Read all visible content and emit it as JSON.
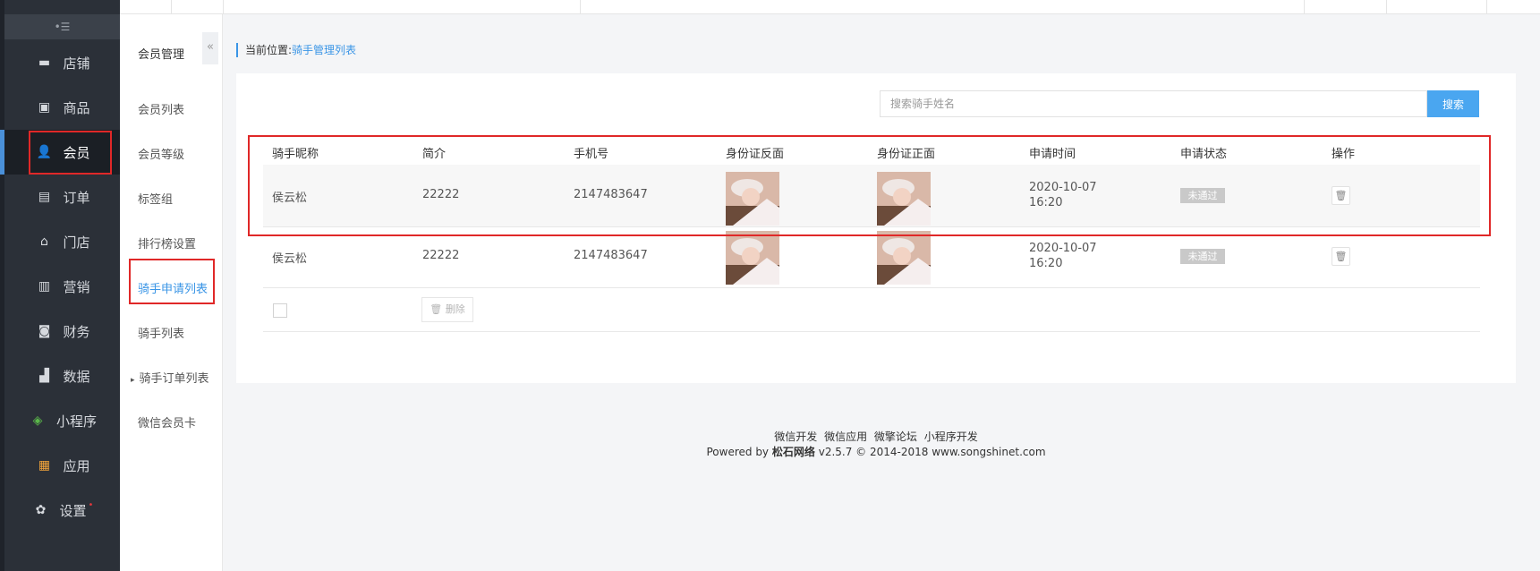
{
  "sidebar": {
    "collapse_glyph": "•☰",
    "items": [
      {
        "label": "店铺",
        "icon": "store-icon",
        "glyph": "▬"
      },
      {
        "label": "商品",
        "icon": "goods-icon",
        "glyph": "▣"
      },
      {
        "label": "会员",
        "icon": "member-icon",
        "glyph": "👤"
      },
      {
        "label": "订单",
        "icon": "order-icon",
        "glyph": "▤"
      },
      {
        "label": "门店",
        "icon": "shop-icon",
        "glyph": "⌂"
      },
      {
        "label": "营销",
        "icon": "gift-icon",
        "glyph": "▥"
      },
      {
        "label": "财务",
        "icon": "money-bag-icon",
        "glyph": "◙"
      },
      {
        "label": "数据",
        "icon": "chart-icon",
        "glyph": "▟"
      },
      {
        "label": "小程序",
        "icon": "miniprogram-icon",
        "glyph": "◈"
      },
      {
        "label": "应用",
        "icon": "apps-icon",
        "glyph": "▦"
      },
      {
        "label": "设置",
        "icon": "gear-icon",
        "glyph": "✿",
        "dot": "•"
      }
    ]
  },
  "subnav": {
    "title": "会员管理",
    "fold_glyph": "«",
    "items": [
      {
        "label": "会员列表"
      },
      {
        "label": "会员等级"
      },
      {
        "label": "标签组"
      },
      {
        "label": "排行榜设置"
      },
      {
        "label": "骑手申请列表"
      },
      {
        "label": "骑手列表"
      },
      {
        "label": "骑手订单列表",
        "tri": "▸"
      },
      {
        "label": "微信会员卡"
      }
    ]
  },
  "breadcrumb": {
    "prefix": "当前位置:",
    "current": "骑手管理列表"
  },
  "search": {
    "placeholder": "搜索骑手姓名",
    "button": "搜索"
  },
  "table": {
    "headers": [
      "骑手昵称",
      "简介",
      "手机号",
      "身份证反面",
      "身份证正面",
      "申请时间",
      "申请状态",
      "操作"
    ],
    "rows": [
      {
        "name": "侯云松",
        "intro": "22222",
        "phone": "2147483647",
        "date": "2020-10-07",
        "time": "16:20",
        "status": "未通过"
      },
      {
        "name": "侯云松",
        "intro": "22222",
        "phone": "2147483647",
        "date": "2020-10-07",
        "time": "16:20",
        "status": "未通过"
      }
    ],
    "bulk_delete": "删除",
    "delete_glyph": "🗑"
  },
  "footer": {
    "links": [
      "微信开发",
      "微信应用",
      "微擎论坛",
      "小程序开发"
    ],
    "powered_prefix": "Powered by",
    "brand": "松石网络",
    "powered_suffix": "v2.5.7 © 2014-2018 www.songshinet.com"
  },
  "colors": {
    "accent": "#3a95e6",
    "sidebar": "#2b3038",
    "highlight": "#e02828",
    "status_badge": "#c9c9c9"
  }
}
